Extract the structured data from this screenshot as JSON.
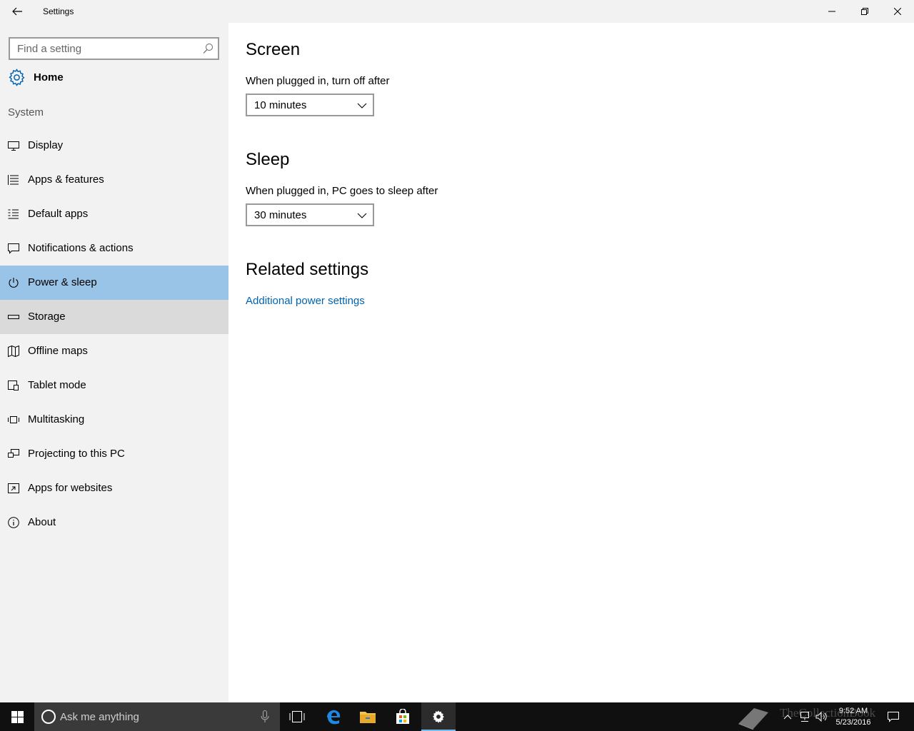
{
  "titlebar": {
    "title": "Settings"
  },
  "sidebar": {
    "search_placeholder": "Find a setting",
    "home_label": "Home",
    "group_label": "System",
    "items": [
      {
        "label": "Display",
        "icon": "display-icon"
      },
      {
        "label": "Apps & features",
        "icon": "apps-features-icon"
      },
      {
        "label": "Default apps",
        "icon": "default-apps-icon"
      },
      {
        "label": "Notifications & actions",
        "icon": "notifications-icon"
      },
      {
        "label": "Power & sleep",
        "icon": "power-icon",
        "selected": true
      },
      {
        "label": "Storage",
        "icon": "storage-icon",
        "hover": true
      },
      {
        "label": "Offline maps",
        "icon": "map-icon"
      },
      {
        "label": "Tablet mode",
        "icon": "tablet-mode-icon"
      },
      {
        "label": "Multitasking",
        "icon": "multitasking-icon"
      },
      {
        "label": "Projecting to this PC",
        "icon": "projecting-icon"
      },
      {
        "label": "Apps for websites",
        "icon": "apps-websites-icon"
      },
      {
        "label": "About",
        "icon": "info-icon"
      }
    ]
  },
  "main": {
    "screen": {
      "heading": "Screen",
      "description": "When plugged in, turn off after",
      "value": "10 minutes"
    },
    "sleep": {
      "heading": "Sleep",
      "description": "When plugged in, PC goes to sleep after",
      "value": "30 minutes"
    },
    "related": {
      "heading": "Related settings",
      "link": "Additional power settings"
    }
  },
  "taskbar": {
    "search_placeholder": "Ask me anything",
    "time": "9:52 AM",
    "date": "5/23/2016",
    "watermark": "TheCollectionBook"
  },
  "colors": {
    "selected_bg": "#99c4e8",
    "hover_bg": "#dadada",
    "link": "#0063b1",
    "taskbar": "#101010",
    "accent": "#76b9ed"
  }
}
